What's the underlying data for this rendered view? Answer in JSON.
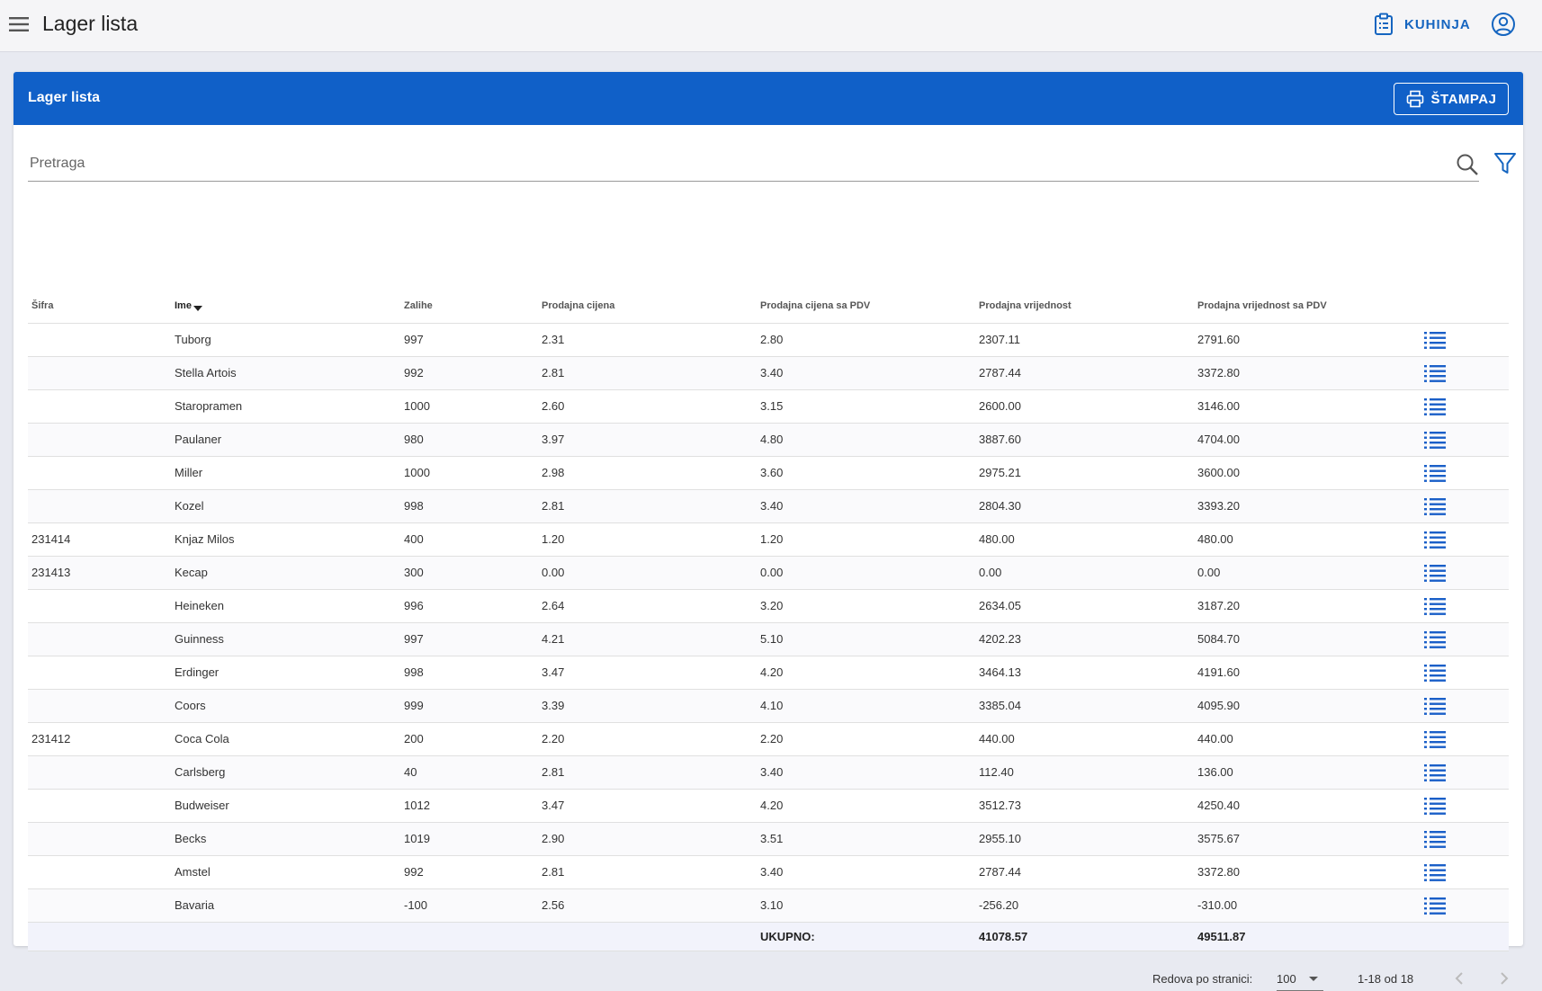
{
  "app": {
    "title": "Lager lista"
  },
  "header": {
    "kitchen_label": "KUHINJA"
  },
  "card": {
    "title": "Lager lista",
    "print_label": "ŠTAMPAJ"
  },
  "search": {
    "placeholder": "Pretraga",
    "value": ""
  },
  "table": {
    "columns": [
      "Šifra",
      "Ime",
      "Zalihe",
      "Prodajna cijena",
      "Prodajna cijena sa PDV",
      "Prodajna vrijednost",
      "Prodajna vrijednost sa PDV"
    ],
    "sorted_column": "Ime",
    "rows": [
      [
        "",
        "Tuborg",
        "997",
        "2.31",
        "2.80",
        "2307.11",
        "2791.60"
      ],
      [
        "",
        "Stella Artois",
        "992",
        "2.81",
        "3.40",
        "2787.44",
        "3372.80"
      ],
      [
        "",
        "Staropramen",
        "1000",
        "2.60",
        "3.15",
        "2600.00",
        "3146.00"
      ],
      [
        "",
        "Paulaner",
        "980",
        "3.97",
        "4.80",
        "3887.60",
        "4704.00"
      ],
      [
        "",
        "Miller",
        "1000",
        "2.98",
        "3.60",
        "2975.21",
        "3600.00"
      ],
      [
        "",
        "Kozel",
        "998",
        "2.81",
        "3.40",
        "2804.30",
        "3393.20"
      ],
      [
        "231414",
        "Knjaz Milos",
        "400",
        "1.20",
        "1.20",
        "480.00",
        "480.00"
      ],
      [
        "231413",
        "Kecap",
        "300",
        "0.00",
        "0.00",
        "0.00",
        "0.00"
      ],
      [
        "",
        "Heineken",
        "996",
        "2.64",
        "3.20",
        "2634.05",
        "3187.20"
      ],
      [
        "",
        "Guinness",
        "997",
        "4.21",
        "5.10",
        "4202.23",
        "5084.70"
      ],
      [
        "",
        "Erdinger",
        "998",
        "3.47",
        "4.20",
        "3464.13",
        "4191.60"
      ],
      [
        "",
        "Coors",
        "999",
        "3.39",
        "4.10",
        "3385.04",
        "4095.90"
      ],
      [
        "231412",
        "Coca Cola",
        "200",
        "2.20",
        "2.20",
        "440.00",
        "440.00"
      ],
      [
        "",
        "Carlsberg",
        "40",
        "2.81",
        "3.40",
        "112.40",
        "136.00"
      ],
      [
        "",
        "Budweiser",
        "1012",
        "3.47",
        "4.20",
        "3512.73",
        "4250.40"
      ],
      [
        "",
        "Becks",
        "1019",
        "2.90",
        "3.51",
        "2955.10",
        "3575.67"
      ],
      [
        "",
        "Amstel",
        "992",
        "2.81",
        "3.40",
        "2787.44",
        "3372.80"
      ],
      [
        "",
        "Bavaria",
        "-100",
        "2.56",
        "3.10",
        "-256.20",
        "-310.00"
      ]
    ],
    "total": {
      "label": "UKUPNO:",
      "value": "41078.57",
      "value_vat": "49511.87"
    }
  },
  "pagination": {
    "rows_per_page_label": "Redova po stranici:",
    "rows_per_page": "100",
    "range": "1-18 od 18"
  },
  "colors": {
    "accent": "#1060c8",
    "link": "#1565c0",
    "background": "#e8eaf1"
  },
  "icons": [
    "menu-icon",
    "clipboard-icon",
    "account-circle-icon",
    "printer-icon",
    "search-icon",
    "filter-icon",
    "list-icon",
    "chevron-left-icon",
    "chevron-right-icon"
  ]
}
